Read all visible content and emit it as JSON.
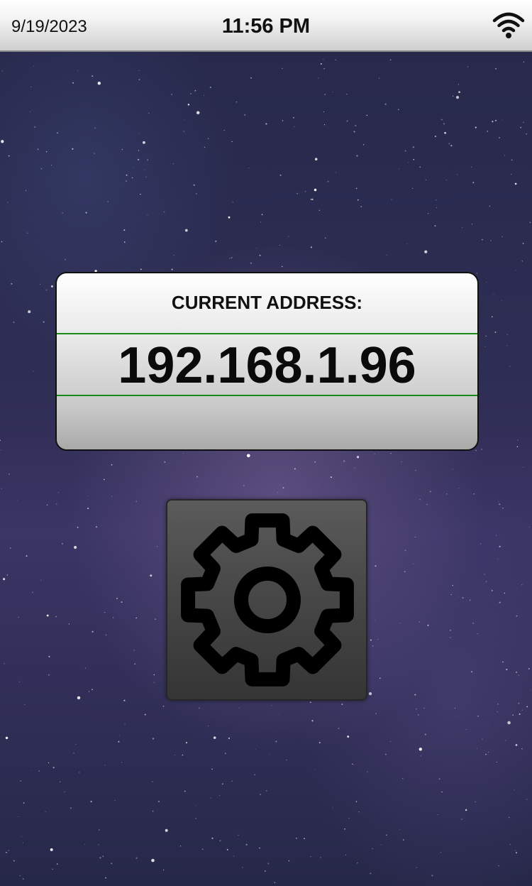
{
  "status_bar": {
    "date": "9/19/2023",
    "time": "11:56 PM",
    "wifi_icon": "wifi-icon"
  },
  "address_card": {
    "label": "CURRENT ADDRESS:",
    "ip_address": "192.168.1.96",
    "divider_color": "#1a8a1a"
  },
  "settings_button": {
    "icon": "gear-icon"
  },
  "colors": {
    "background": "#2a2c4f",
    "button_face": "#484848"
  }
}
